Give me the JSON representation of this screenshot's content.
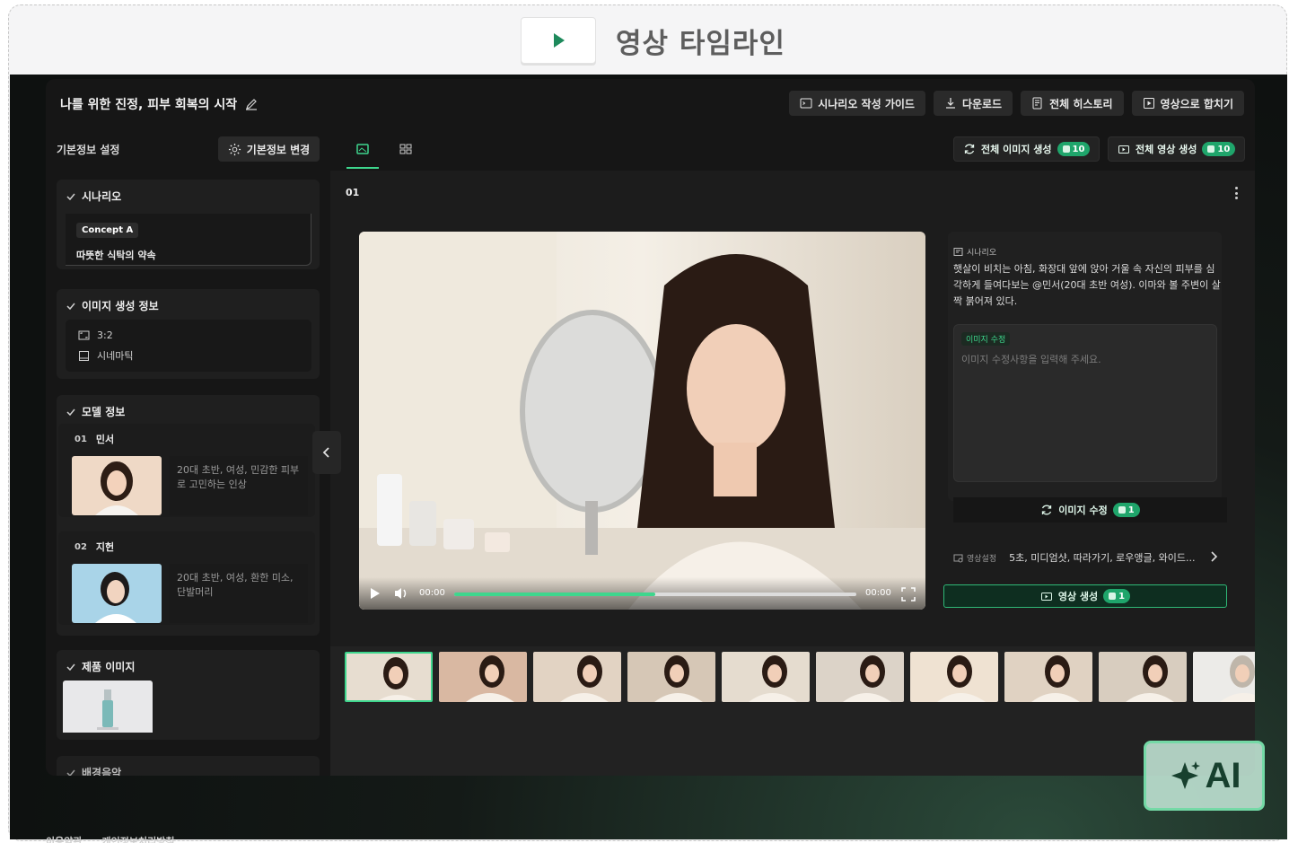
{
  "header": {
    "title": "영상 타임라인",
    "play_icon": "play-icon"
  },
  "project": {
    "title": "나를 위한 진정, 피부 회복의 시작"
  },
  "toolbar": {
    "guide_label": "시나리오 작성 가이드",
    "download_label": "다운로드",
    "history_label": "전체 히스토리",
    "merge_label": "영상으로 합치기"
  },
  "sidebar": {
    "heading": "기본정보 설정",
    "edit_button": "기본정보 변경",
    "scenario": {
      "title": "시나리오",
      "concept_badge": "Concept A",
      "concept_text": "따뜻한 식탁의 약속"
    },
    "image_info": {
      "title": "이미지 생성 정보",
      "ratio": "3:2",
      "style": "시네마틱"
    },
    "models": {
      "title": "모델 정보",
      "items": [
        {
          "num": "01",
          "name": "민서",
          "desc": "20대 초반, 여성, 민감한 피부로 고민하는 인상"
        },
        {
          "num": "02",
          "name": "지헌",
          "desc": "20대 초반, 여성, 환한 미소, 단발머리"
        }
      ]
    },
    "product": {
      "title": "제품 이미지"
    },
    "bgm": {
      "title": "배경음악"
    }
  },
  "main": {
    "gen_all_images": "전체 이미지 생성",
    "gen_all_images_count": "10",
    "gen_all_videos": "전체 영상 생성",
    "gen_all_videos_count": "10",
    "scene_number": "01",
    "video": {
      "time_current": "00:00",
      "time_total": "00:00",
      "progress": 0.5
    },
    "scenario_label": "시나리오",
    "scenario_text": "햇살이 비치는 아침, 화장대 앞에 앉아 거울 속 자신의 피부를 심각하게 들여다보는 @민서(20대 초반 여성). 이마와 볼 주변이 살짝 붉어져 있다.",
    "edit_tag": "이미지 수정",
    "edit_placeholder": "이미지 수정사항을 입력해 주세요.",
    "edit_button": "이미지 수정",
    "edit_count": "1",
    "video_setting_label": "영상설정",
    "video_setting_value": "5초, 미디엄샷, 따라가기, 로우앵글, 와이드...",
    "video_gen_button": "영상 생성",
    "video_gen_count": "1"
  },
  "footer": {
    "terms": "이용약관",
    "privacy": "개인정보처리방침"
  },
  "ai_button": {
    "label": "AI"
  },
  "colors": {
    "accent": "#3ed68d",
    "panel": "#161616"
  }
}
